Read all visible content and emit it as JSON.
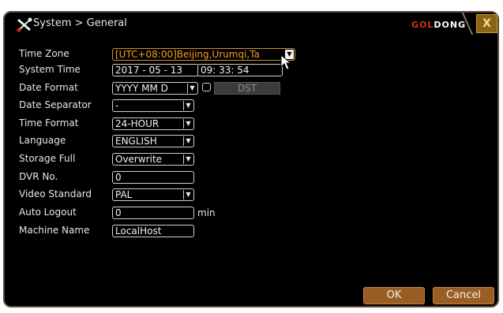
{
  "window": {
    "title": "System > General",
    "brand": {
      "part1": "GOL",
      "part2": "DONG"
    },
    "close_label": "X"
  },
  "settings": {
    "time_zone": {
      "label": "Time Zone",
      "value": "[UTC+08:00]Beijing,Urumqi,Ta"
    },
    "system_time": {
      "label": "System Time",
      "date": "2017 - 05 - 13",
      "time": "09: 33: 54"
    },
    "date_format": {
      "label": "Date Format",
      "value": "YYYY MM D"
    },
    "dst": {
      "checked": false,
      "button_label": "DST"
    },
    "date_separator": {
      "label": "Date Separator",
      "value": "-"
    },
    "time_format": {
      "label": "Time Format",
      "value": "24-HOUR"
    },
    "language": {
      "label": "Language",
      "value": "ENGLISH"
    },
    "storage_full": {
      "label": "Storage Full",
      "value": "Overwrite"
    },
    "dvr_no": {
      "label": "DVR No.",
      "value": "0"
    },
    "video_standard": {
      "label": "Video Standard",
      "value": "PAL"
    },
    "auto_logout": {
      "label": "Auto Logout",
      "value": "0",
      "unit": "min"
    },
    "machine_name": {
      "label": "Machine Name",
      "value": "LocalHost"
    }
  },
  "actions": {
    "ok": "OK",
    "cancel": "Cancel"
  },
  "colors": {
    "highlight": "#f0a020",
    "button": "#9a5e25",
    "brand_red": "#d83018"
  }
}
